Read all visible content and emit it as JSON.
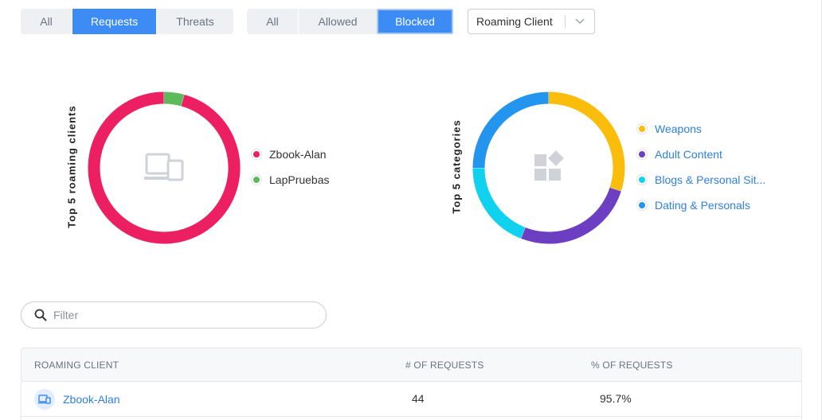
{
  "filters": {
    "type_tabs": [
      {
        "label": "All",
        "active": false
      },
      {
        "label": "Requests",
        "active": true
      },
      {
        "label": "Threats",
        "active": false
      }
    ],
    "status_tabs": [
      {
        "label": "All",
        "active": false
      },
      {
        "label": "Allowed",
        "active": false
      },
      {
        "label": "Blocked",
        "active": true
      }
    ],
    "group_select": {
      "value": "Roaming Client"
    }
  },
  "charts": {
    "clients": {
      "label": "Top 5 roaming clients",
      "center_icon": "devices-icon",
      "legend": [
        {
          "label": "Zbook-Alan",
          "color": "#ec1f63"
        },
        {
          "label": "LapPruebas",
          "color": "#5cba5d"
        }
      ]
    },
    "categories": {
      "label": "Top 5 categories",
      "center_icon": "categories-icon",
      "legend": [
        {
          "label": "Weapons",
          "color": "#fbbd0b"
        },
        {
          "label": "Adult Content",
          "color": "#6c3fc2"
        },
        {
          "label": "Blogs & Personal Sit...",
          "color": "#10d2ef"
        },
        {
          "label": "Dating & Personals",
          "color": "#2395ef"
        }
      ]
    }
  },
  "chart_data": [
    {
      "type": "pie",
      "categories": [
        "Zbook-Alan",
        "LapPruebas"
      ],
      "values": [
        95.7,
        4.3
      ],
      "colors": [
        "#ec1f63",
        "#5cba5d"
      ]
    },
    {
      "type": "pie",
      "categories": [
        "Weapons",
        "Adult Content",
        "Blogs & Personal Sit...",
        "Dating & Personals"
      ],
      "values": [
        30,
        26,
        19,
        25
      ],
      "colors": [
        "#fbbd0b",
        "#6c3fc2",
        "#10d2ef",
        "#2395ef"
      ]
    }
  ],
  "filter": {
    "placeholder": "Filter"
  },
  "table": {
    "columns": [
      "ROAMING CLIENT",
      "# OF REQUESTS",
      "% OF REQUESTS"
    ],
    "rows": [
      {
        "client": "Zbook-Alan",
        "requests": "44",
        "percent": "95.7%"
      }
    ]
  }
}
